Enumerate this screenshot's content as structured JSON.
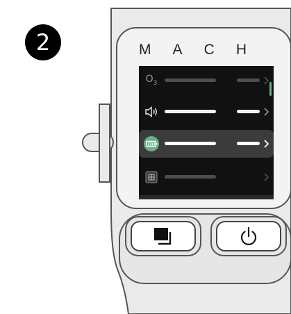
{
  "step": {
    "number": "2"
  },
  "device": {
    "brand_letters": [
      "M",
      "A",
      "C",
      "H"
    ],
    "menu_items": [
      {
        "icon": "o3-icon",
        "icon_text": "O",
        "icon_sub": "3",
        "state": "dim"
      },
      {
        "icon": "speaker-icon",
        "state": "normal"
      },
      {
        "icon": "battery-icon",
        "state": "selected"
      },
      {
        "icon": "grid-icon",
        "state": "dim"
      }
    ],
    "buttons": [
      {
        "name": "layers-button",
        "icon": "layers-icon"
      },
      {
        "name": "power-button",
        "icon": "power-icon"
      }
    ],
    "colors": {
      "screen_bg": "#111111",
      "selected_row_bg": "#3b3b3b",
      "battery_accent": "#6bb08a",
      "body_fill": "#eaeaea",
      "body_outline": "#555555"
    }
  }
}
